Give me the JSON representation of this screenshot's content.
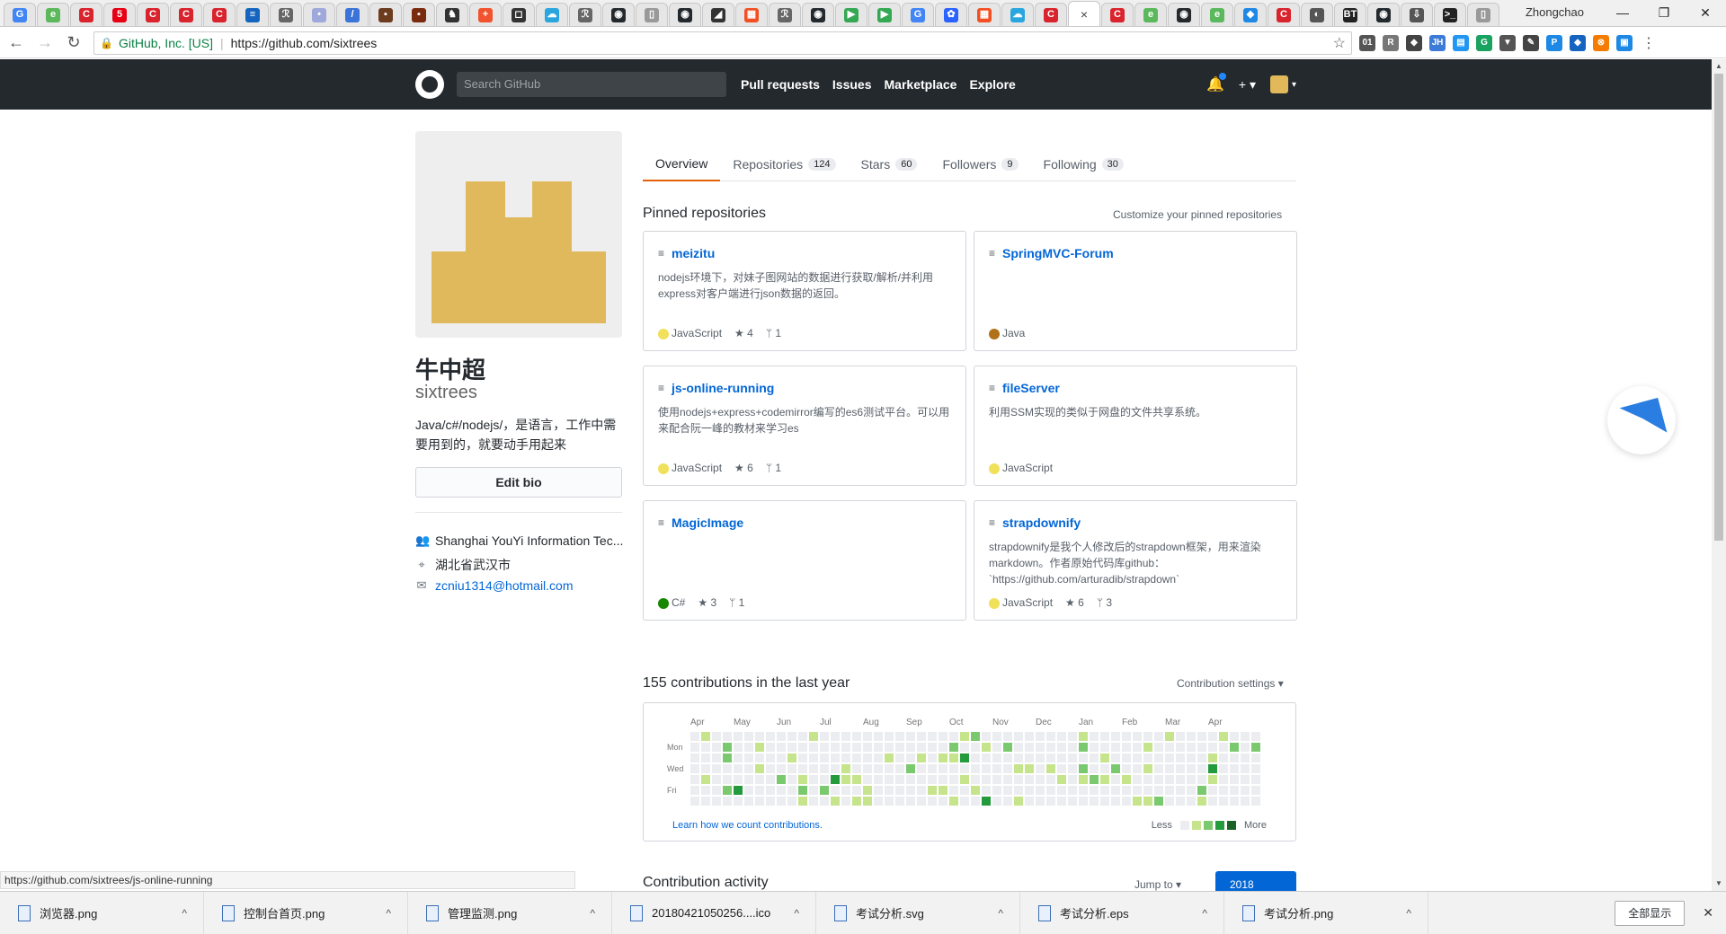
{
  "browser": {
    "tabs": [
      {
        "fav": "G",
        "color": "#4285f4"
      },
      {
        "fav": "e",
        "color": "#5cb85c"
      },
      {
        "fav": "C",
        "color": "#d9232d"
      },
      {
        "fav": "5",
        "color": "#e60012"
      },
      {
        "fav": "C",
        "color": "#d9232d"
      },
      {
        "fav": "C",
        "color": "#d9232d"
      },
      {
        "fav": "C",
        "color": "#d9232d"
      },
      {
        "fav": "≡",
        "color": "#1565c0"
      },
      {
        "fav": "ℛ",
        "color": "#666666"
      },
      {
        "fav": "•",
        "color": "#9fa8da"
      },
      {
        "fav": "/",
        "color": "#3b73d9"
      },
      {
        "fav": "▪",
        "color": "#6d3b1e"
      },
      {
        "fav": "▪",
        "color": "#7a2a0f"
      },
      {
        "fav": "♞",
        "color": "#333333"
      },
      {
        "fav": "+",
        "color": "#f0532d"
      },
      {
        "fav": "◻",
        "color": "#333333"
      },
      {
        "fav": "☁",
        "color": "#2aa6df"
      },
      {
        "fav": "ℛ",
        "color": "#666666"
      },
      {
        "fav": "◉",
        "color": "#24292e"
      },
      {
        "fav": "▯",
        "color": "#999999"
      },
      {
        "fav": "◉",
        "color": "#24292e"
      },
      {
        "fav": "◢",
        "color": "#333333"
      },
      {
        "fav": "▦",
        "color": "#f25022"
      },
      {
        "fav": "ℛ",
        "color": "#666666"
      },
      {
        "fav": "◉",
        "color": "#24292e"
      },
      {
        "fav": "▶",
        "color": "#34a853"
      },
      {
        "fav": "▶",
        "color": "#34a853"
      },
      {
        "fav": "G",
        "color": "#4285f4"
      },
      {
        "fav": "✿",
        "color": "#2962ff"
      },
      {
        "fav": "▦",
        "color": "#f25022"
      },
      {
        "fav": "☁",
        "color": "#2aa6df"
      },
      {
        "fav": "C",
        "color": "#d9232d"
      },
      {
        "fav": "",
        "color": "#ffffff",
        "active": true
      },
      {
        "fav": "C",
        "color": "#d9232d"
      },
      {
        "fav": "e",
        "color": "#5cb85c"
      },
      {
        "fav": "◉",
        "color": "#24292e"
      },
      {
        "fav": "e",
        "color": "#5cb85c"
      },
      {
        "fav": "◆",
        "color": "#1e88e5"
      },
      {
        "fav": "C",
        "color": "#d9232d"
      },
      {
        "fav": "◐",
        "color": "#555555"
      },
      {
        "fav": "BT",
        "color": "#222222"
      },
      {
        "fav": "◉",
        "color": "#24292e"
      },
      {
        "fav": "⇩",
        "color": "#555555"
      },
      {
        "fav": ">_",
        "color": "#222222"
      },
      {
        "fav": "▯",
        "color": "#999999"
      }
    ],
    "user": "Zhongchao",
    "secure_label": "GitHub, Inc. [US]",
    "url": "https://github.com/sixtrees",
    "status_url": "https://github.com/sixtrees/js-online-running",
    "extensions": [
      {
        "t": "01",
        "c": "#555555"
      },
      {
        "t": "R",
        "c": "#777777"
      },
      {
        "t": "◆",
        "c": "#444444"
      },
      {
        "t": "JH",
        "c": "#3d7bd9"
      },
      {
        "t": "▤",
        "c": "#2196f3"
      },
      {
        "t": "G",
        "c": "#1aa260"
      },
      {
        "t": "▼",
        "c": "#555555"
      },
      {
        "t": "✎",
        "c": "#444444"
      },
      {
        "t": "P",
        "c": "#1e88e5"
      },
      {
        "t": "◆",
        "c": "#1565c0"
      },
      {
        "t": "⊗",
        "c": "#f57c00"
      },
      {
        "t": "▣",
        "c": "#1e88e5"
      }
    ]
  },
  "github": {
    "search_placeholder": "Search GitHub",
    "nav": [
      "Pull requests",
      "Issues",
      "Marketplace",
      "Explore"
    ],
    "plus": "+ ▾",
    "avatar_caret": "▾"
  },
  "profile": {
    "fullname": "牛中超",
    "username": "sixtrees",
    "bio": "Java/c#/nodejs/，是语言，工作中需要用到的，就要动手用起来",
    "edit_bio": "Edit bio",
    "company": "Shanghai YouYi Information Tec...",
    "location": "湖北省武汉市",
    "email": "zcniu1314@hotmail.com"
  },
  "tabs": [
    {
      "label": "Overview",
      "count": null,
      "active": true
    },
    {
      "label": "Repositories",
      "count": "124"
    },
    {
      "label": "Stars",
      "count": "60"
    },
    {
      "label": "Followers",
      "count": "9"
    },
    {
      "label": "Following",
      "count": "30"
    }
  ],
  "pinned": {
    "title": "Pinned repositories",
    "customize": "Customize your pinned repositories",
    "repos": [
      {
        "name": "meizitu",
        "desc": "nodejs环境下，对妹子图网站的数据进行获取/解析/并利用express对客户端进行json数据的返回。",
        "lang": "JavaScript",
        "color": "#f1e05a",
        "stars": "4",
        "forks": "1"
      },
      {
        "name": "SpringMVC-Forum",
        "desc": "",
        "lang": "Java",
        "color": "#b07219",
        "stars": "",
        "forks": ""
      },
      {
        "name": "js-online-running",
        "desc": "使用nodejs+express+codemirror编写的es6测试平台。可以用来配合阮一峰的教材来学习es",
        "lang": "JavaScript",
        "color": "#f1e05a",
        "stars": "6",
        "forks": "1"
      },
      {
        "name": "fileServer",
        "desc": "利用SSM实现的类似于网盘的文件共享系统。",
        "lang": "JavaScript",
        "color": "#f1e05a",
        "stars": "",
        "forks": ""
      },
      {
        "name": "MagicImage",
        "desc": "",
        "lang": "C#",
        "color": "#178600",
        "stars": "3",
        "forks": "1"
      },
      {
        "name": "strapdownify",
        "desc": "strapdownify是我个人修改后的strapdown框架，用来渲染markdown。作者原始代码库github：`https://github.com/arturadib/strapdown`",
        "lang": "JavaScript",
        "color": "#f1e05a",
        "stars": "6",
        "forks": "3"
      }
    ]
  },
  "contributions": {
    "title": "155 contributions in the last year",
    "settings": "Contribution settings ▾",
    "months": [
      "Apr",
      "May",
      "Jun",
      "Jul",
      "Aug",
      "Sep",
      "Oct",
      "Nov",
      "Dec",
      "Jan",
      "Feb",
      "Mar",
      "Apr"
    ],
    "days": [
      "Mon",
      "Wed",
      "Fri"
    ],
    "learn": "Learn how we count contributions.",
    "less": "Less",
    "more": "More",
    "palette": [
      "#ebedf0",
      "#c6e48b",
      "#7bc96f",
      "#239a3b",
      "#196127"
    ]
  },
  "activity": {
    "title": "Contribution activity",
    "jump": "Jump to ▾",
    "year": "2018"
  },
  "downloads": {
    "files": [
      "浏览器.png",
      "控制台首页.png",
      "管理监测.png",
      "20180421050256....ico",
      "考试分析.svg",
      "考试分析.eps",
      "考试分析.png"
    ],
    "show_all": "全部显示"
  }
}
